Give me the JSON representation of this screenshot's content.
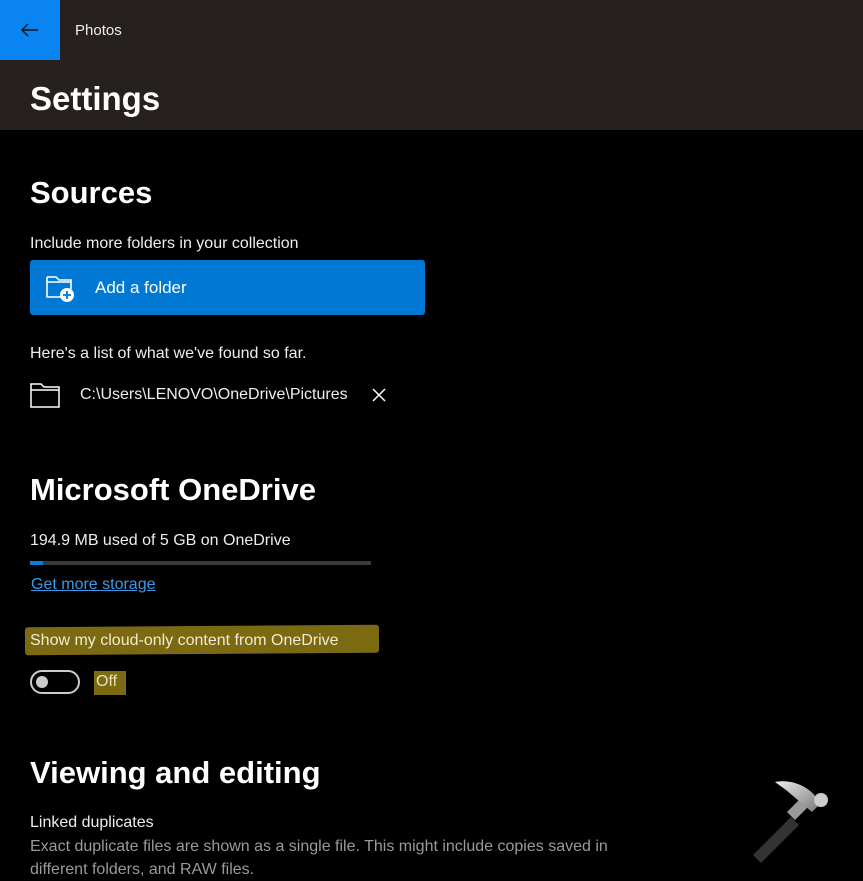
{
  "header": {
    "app_title": "Photos",
    "page_title": "Settings"
  },
  "sources": {
    "heading": "Sources",
    "include_label": "Include more folders in your collection",
    "add_folder_label": "Add a folder",
    "found_label": "Here's a list of what we've found so far.",
    "folders": [
      {
        "path": "C:\\Users\\LENOVO\\OneDrive\\Pictures"
      }
    ]
  },
  "onedrive": {
    "heading": "Microsoft OneDrive",
    "usage_text": "194.9 MB used of 5 GB on OneDrive",
    "usage_percent": 3.9,
    "get_more_storage": "Get more storage",
    "cloud_only_label": "Show my cloud-only content from OneDrive",
    "toggle_state": "Off"
  },
  "viewing": {
    "heading": "Viewing and editing",
    "linked_duplicates_label": "Linked duplicates",
    "linked_duplicates_desc_1": "Exact duplicate files are shown as a single file. This might include copies saved in",
    "linked_duplicates_desc_2": "different folders, and RAW files."
  },
  "colors": {
    "accent": "#0078d4",
    "back_button": "#0a84f0",
    "highlight": "#7c6a13"
  }
}
